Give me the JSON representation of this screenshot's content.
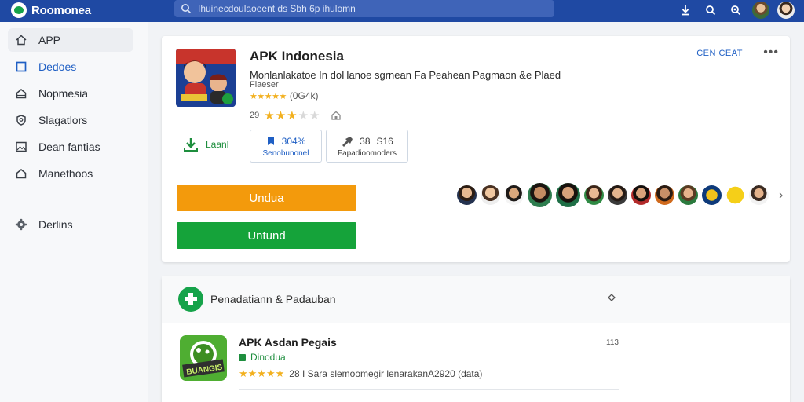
{
  "app": {
    "name": "Roomonea"
  },
  "search": {
    "placeholder": "Ihuinecdoulaoeent ds Sbh 6p ihulomn"
  },
  "colors": {
    "topbar": "#1f49a3",
    "accent_blue": "#1f5fc4",
    "orange": "#f39a0c",
    "green": "#15a33a",
    "star": "#f2b01e"
  },
  "sidebar": {
    "items": [
      {
        "label": "APP",
        "icon": "home-icon"
      },
      {
        "label": "Dedoes",
        "icon": "square-icon"
      },
      {
        "label": "Nopmesia",
        "icon": "home-outline-icon"
      },
      {
        "label": "Slagatlors",
        "icon": "shield-icon"
      },
      {
        "label": "Dean fantias",
        "icon": "image-icon"
      },
      {
        "label": "Manethoos",
        "icon": "home-outline-icon"
      },
      {
        "label": "Derlins",
        "icon": "gear-icon"
      }
    ]
  },
  "main": {
    "title": "APK Indonesia",
    "description": "Monlanlakatoe In doHanoe sgrnean Fa Peahean Pagmaon &e Plaed",
    "subtitle": "Fiaeser",
    "rating_count": "(0G4k)",
    "rating_label": "29",
    "card_link": "CEN CEAT",
    "install_label": "Laanl",
    "stat1": {
      "value": "304%",
      "label": "Senobunonel"
    },
    "stat2": {
      "value1": "38",
      "value2": "S16",
      "label": "Fapadioomoders"
    },
    "btn_primary": "Undua",
    "btn_secondary": "Untund"
  },
  "section2": {
    "title": "Penadatiann & Padauban",
    "app": {
      "name": "APK Asdan Pegais",
      "badge": "Dinodua",
      "rating_text": "28 I Sara slemoomegir lenarakanA2920 (data)",
      "count": "113",
      "icon_text": "BUANGIS"
    }
  }
}
